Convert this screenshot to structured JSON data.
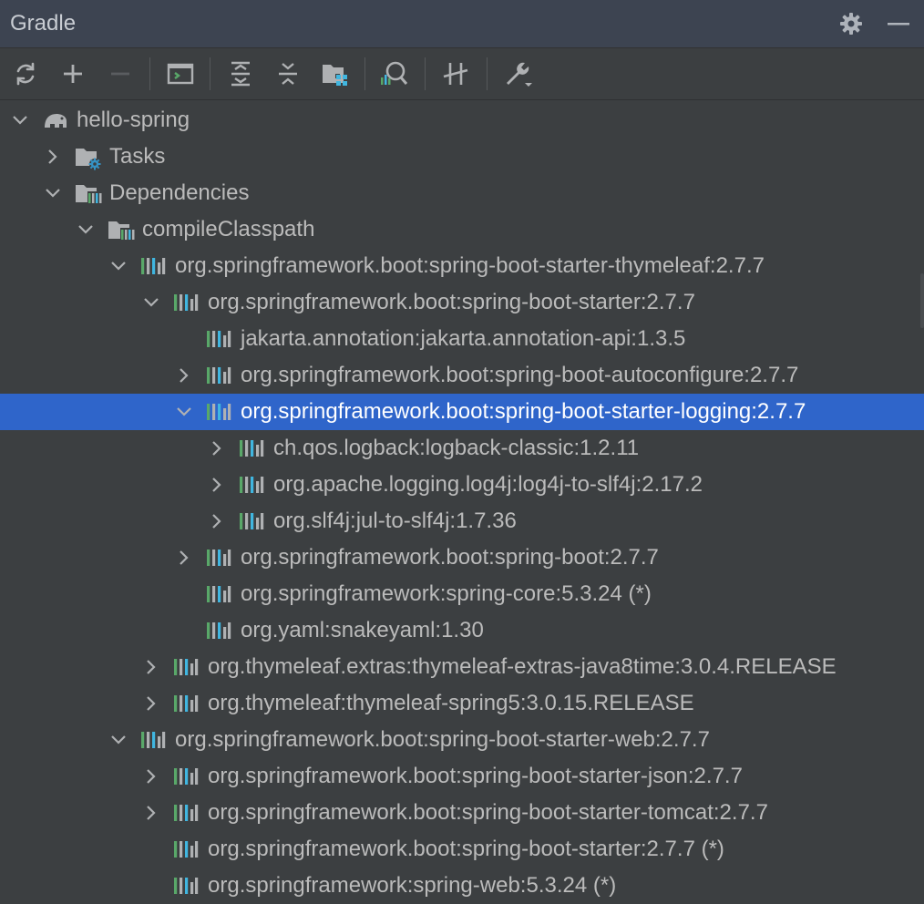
{
  "panel": {
    "title": "Gradle",
    "header_icons": [
      "gear-icon",
      "minimize-icon"
    ]
  },
  "toolbar": {
    "buttons": [
      {
        "icon": "refresh-icon"
      },
      {
        "icon": "add-icon"
      },
      {
        "icon": "remove-icon",
        "disabled": true
      },
      {
        "icon": "terminal-icon"
      },
      {
        "icon": "expand-all-icon"
      },
      {
        "icon": "collapse-all-icon"
      },
      {
        "icon": "folder-grid-icon"
      },
      {
        "icon": "analyze-dependencies-icon"
      },
      {
        "icon": "toggle-offline-icon"
      },
      {
        "icon": "wrench-settings-icon"
      }
    ]
  },
  "tree": {
    "selected_index": 8,
    "rows": [
      {
        "level": 0,
        "expand": "expanded",
        "icon": "gradle-elephant-icon",
        "label": "hello-spring"
      },
      {
        "level": 1,
        "expand": "collapsed",
        "icon": "tasks-folder-icon",
        "label": "Tasks"
      },
      {
        "level": 1,
        "expand": "expanded",
        "icon": "dependencies-folder-icon",
        "label": "Dependencies"
      },
      {
        "level": 2,
        "expand": "expanded",
        "icon": "configuration-icon",
        "label": "compileClasspath"
      },
      {
        "level": 3,
        "expand": "expanded",
        "icon": "library-icon",
        "label": "org.springframework.boot:spring-boot-starter-thymeleaf:2.7.7"
      },
      {
        "level": 4,
        "expand": "expanded",
        "icon": "library-icon",
        "label": "org.springframework.boot:spring-boot-starter:2.7.7"
      },
      {
        "level": 5,
        "expand": "none",
        "icon": "library-icon",
        "label": "jakarta.annotation:jakarta.annotation-api:1.3.5"
      },
      {
        "level": 5,
        "expand": "collapsed",
        "icon": "library-icon",
        "label": "org.springframework.boot:spring-boot-autoconfigure:2.7.7"
      },
      {
        "level": 5,
        "expand": "expanded",
        "icon": "library-icon",
        "label": "org.springframework.boot:spring-boot-starter-logging:2.7.7"
      },
      {
        "level": 6,
        "expand": "collapsed",
        "icon": "library-icon",
        "label": "ch.qos.logback:logback-classic:1.2.11"
      },
      {
        "level": 6,
        "expand": "collapsed",
        "icon": "library-icon",
        "label": "org.apache.logging.log4j:log4j-to-slf4j:2.17.2"
      },
      {
        "level": 6,
        "expand": "collapsed",
        "icon": "library-icon",
        "label": "org.slf4j:jul-to-slf4j:1.7.36"
      },
      {
        "level": 5,
        "expand": "collapsed",
        "icon": "library-icon",
        "label": "org.springframework.boot:spring-boot:2.7.7"
      },
      {
        "level": 5,
        "expand": "none",
        "icon": "library-icon",
        "label": "org.springframework:spring-core:5.3.24 (*)"
      },
      {
        "level": 5,
        "expand": "none",
        "icon": "library-icon",
        "label": "org.yaml:snakeyaml:1.30"
      },
      {
        "level": 4,
        "expand": "collapsed",
        "icon": "library-icon",
        "label": "org.thymeleaf.extras:thymeleaf-extras-java8time:3.0.4.RELEASE"
      },
      {
        "level": 4,
        "expand": "collapsed",
        "icon": "library-icon",
        "label": "org.thymeleaf:thymeleaf-spring5:3.0.15.RELEASE"
      },
      {
        "level": 3,
        "expand": "expanded",
        "icon": "library-icon",
        "label": "org.springframework.boot:spring-boot-starter-web:2.7.7"
      },
      {
        "level": 4,
        "expand": "collapsed",
        "icon": "library-icon",
        "label": "org.springframework.boot:spring-boot-starter-json:2.7.7"
      },
      {
        "level": 4,
        "expand": "collapsed",
        "icon": "library-icon",
        "label": "org.springframework.boot:spring-boot-starter-tomcat:2.7.7"
      },
      {
        "level": 4,
        "expand": "none",
        "icon": "library-icon",
        "label": "org.springframework.boot:spring-boot-starter:2.7.7 (*)"
      },
      {
        "level": 4,
        "expand": "none",
        "icon": "library-icon",
        "label": "org.springframework:spring-web:5.3.24 (*)"
      }
    ]
  },
  "colors": {
    "panel_bg": "#3c3f41",
    "header_bg": "#3d4451",
    "selection": "#2f65ca",
    "text": "#bbbbbb",
    "selected_text": "#ffffff",
    "icon": "#afb1b3",
    "lib_green": "#59a869",
    "lib_blue": "#40b6e0",
    "gear_blue": "#3592c4"
  }
}
